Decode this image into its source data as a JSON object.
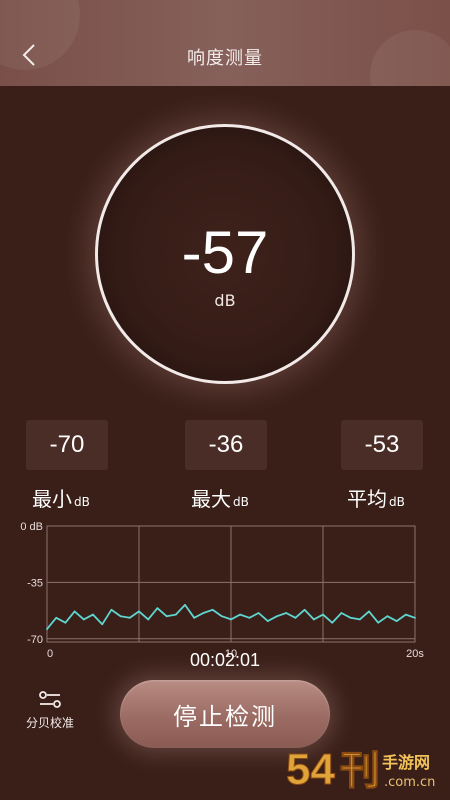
{
  "header": {
    "title": "响度测量",
    "back_icon": "back-chevron-icon"
  },
  "gauge": {
    "value": "-57",
    "unit": "dB"
  },
  "stats": [
    {
      "value": "-70",
      "label": "最小",
      "unit": "dB"
    },
    {
      "value": "-36",
      "label": "最大",
      "unit": "dB"
    },
    {
      "value": "-53",
      "label": "平均",
      "unit": "dB"
    }
  ],
  "chart_data": {
    "type": "line",
    "xlabel": "",
    "ylabel": "",
    "y_tick_labels": [
      "0 dB",
      "-35",
      "-70"
    ],
    "y_ticks": [
      0,
      -35,
      -70
    ],
    "x_tick_labels": [
      "0",
      "10",
      "20s"
    ],
    "x_ticks": [
      0,
      10,
      20
    ],
    "ylim": [
      -72,
      0
    ],
    "xlim": [
      0,
      20
    ],
    "grid": true,
    "line_color": "#5fd6d0",
    "series": [
      {
        "x": [
          0,
          0.5,
          1,
          1.5,
          2,
          2.5,
          3,
          3.5,
          4,
          4.5,
          5,
          5.5,
          6,
          6.5,
          7,
          7.5,
          8,
          8.5,
          9,
          9.5,
          10,
          10.5,
          11,
          11.5,
          12,
          12.5,
          13,
          13.5,
          14,
          14.5,
          15,
          15.5,
          16,
          16.5,
          17,
          17.5,
          18,
          18.5,
          19,
          19.5,
          20
        ],
        "y": [
          -64,
          -57,
          -60,
          -53,
          -58,
          -55,
          -61,
          -52,
          -56,
          -57,
          -53,
          -58,
          -51,
          -56,
          -55,
          -49,
          -57,
          -54,
          -52,
          -56,
          -58,
          -55,
          -57,
          -54,
          -59,
          -56,
          -54,
          -57,
          -52,
          -58,
          -55,
          -60,
          -54,
          -57,
          -58,
          -53,
          -60,
          -56,
          -59,
          -55,
          -57
        ]
      }
    ]
  },
  "timer": "00:02:01",
  "calibration": {
    "label": "分贝校准",
    "icon": "calibration-sliders-icon"
  },
  "stop_button": {
    "label": "停止检测"
  },
  "watermark": {
    "text": "54手游网",
    "sub": ".com.cn"
  }
}
